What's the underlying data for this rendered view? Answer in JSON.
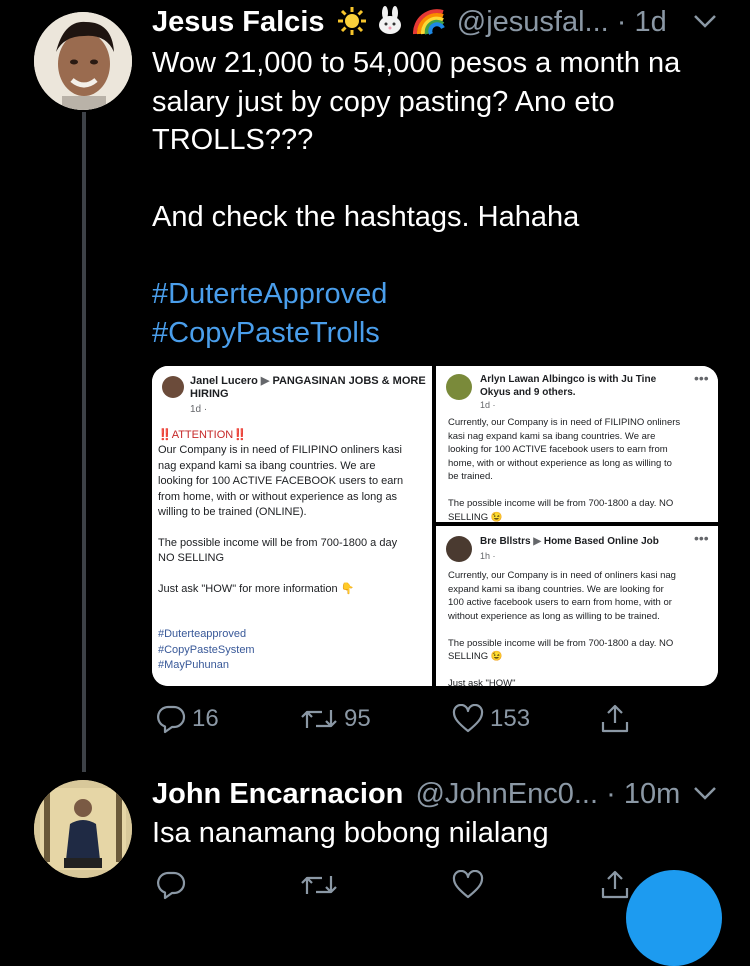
{
  "tweets": [
    {
      "name": "Jesus Falcis",
      "emojis": [
        "sun-emoji",
        "rabbit-emoji",
        "rainbow-emoji"
      ],
      "handle": "@jesusfal...",
      "time": "· 1d",
      "text_lines": [
        "Wow 21,000 to 54,000 pesos a month na",
        "salary just by copy pasting? Ano eto",
        "TROLLS???",
        "",
        "And check the hashtags. Hahaha",
        ""
      ],
      "hashtags": [
        "#DuterteApproved",
        "#CopyPasteTrolls"
      ],
      "actions": {
        "replies": "16",
        "retweets": "95",
        "likes": "153"
      }
    },
    {
      "name": "John Encarnacion",
      "handle": "@JohnEnc0...",
      "time": "· 10m",
      "text": "Isa nanamang bobong nilalang",
      "actions": {
        "replies": "",
        "retweets": "",
        "likes": ""
      }
    }
  ],
  "screenshot_left": {
    "author": "Janel Lucero",
    "group": "PANGASINAN JOBS & MORE HIRING",
    "meta": "1d ·",
    "lines": [
      "‼️ATTENTION‼️",
      "Our Company is in need of FILIPINO onliners kasi",
      "nag expand kami sa ibang countries. We are",
      "looking for 100 ACTIVE FACEBOOK users to earn",
      "from home, with or without experience as long as",
      "willing to be trained (ONLINE).",
      "",
      "The possible income will be from 700-1800 a day",
      "NO SELLING",
      "",
      "Just ask \"HOW\" for more information 👇"
    ],
    "hashtags": [
      "#Duterteapproved",
      "#CopyPasteSystem",
      "#MayPuhunan"
    ]
  },
  "screenshot_top_right": {
    "author_line1": "Arlyn Lawan Albingco is with Ju Tine",
    "author_line2": "Okyus and 9 others.",
    "meta": "1d ·",
    "lines": [
      "Currently, our Company is in need of FILIPINO onliners",
      "kasi nag expand kami sa ibang countries. We are",
      "looking for 100 ACTIVE facebook users to earn from",
      "home, with or without experience as long as willing to",
      "be trained.",
      "",
      "The possible income will be from 700-1800 a day. NO",
      "SELLING 😉"
    ]
  },
  "screenshot_bottom_right": {
    "author": "Bre Bllstrs",
    "group": "Home Based Online Job",
    "meta": "1h ·",
    "lines": [
      "Currently, our Company is in need of onliners kasi nag",
      "expand kami sa ibang countries. We are looking for",
      "100 active facebook users to earn from home, with or",
      "without experience as long as willing to be trained.",
      "",
      "The possible income will be from 700-1800 a day. NO",
      "SELLING 😉",
      "",
      "Just ask \"HOW\""
    ]
  },
  "colors": {
    "background": "#000000",
    "text": "#ffffff",
    "muted": "#8b98a5",
    "link": "#4a9eeb",
    "thread_line": "#3d4147"
  }
}
